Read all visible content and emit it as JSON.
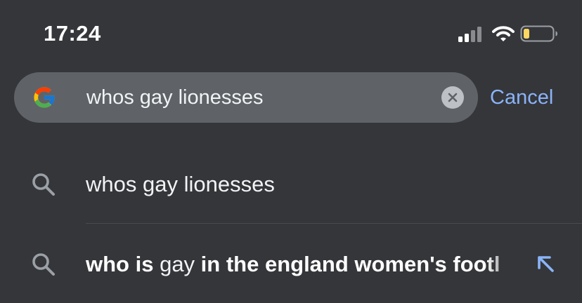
{
  "status_bar": {
    "time": "17:24",
    "icons": [
      "cellular-signal-icon",
      "wifi-icon",
      "battery-low-icon"
    ]
  },
  "search": {
    "query": "whos gay lionesses",
    "cancel_label": "Cancel",
    "logo": "google-g-icon",
    "clear_icon": "clear-icon"
  },
  "suggestions": [
    {
      "icon": "search-icon",
      "text": "whos gay lionesses"
    },
    {
      "icon": "search-icon",
      "parts": [
        "who is ",
        "gay",
        " in the england women's footl"
      ],
      "action_icon": "fill-query-arrow-icon"
    }
  ],
  "colors": {
    "background": "#35363a",
    "search_box": "#5f6368",
    "accent": "#8ab4f8",
    "battery_level": "#fdd663"
  }
}
